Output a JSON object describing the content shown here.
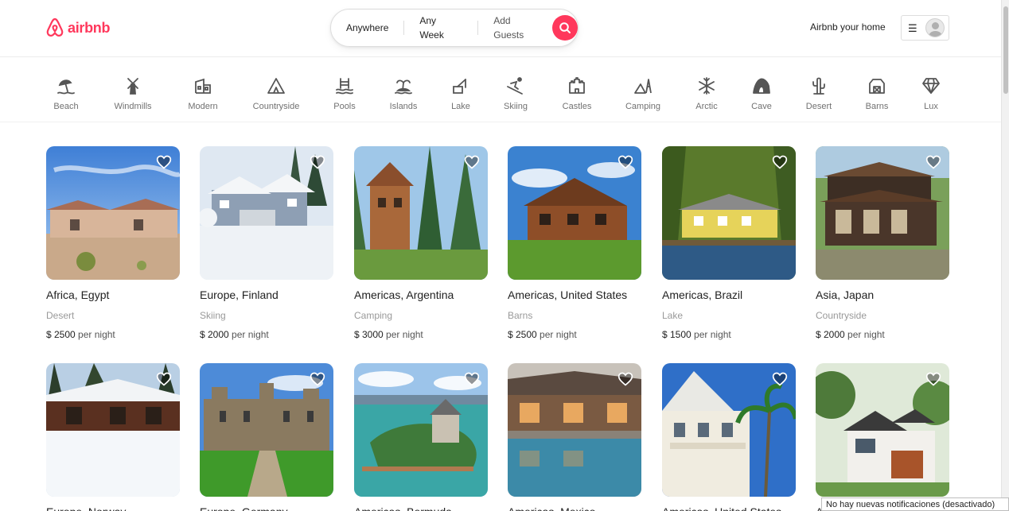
{
  "header": {
    "brand": "airbnb",
    "brand_color": "#ff385c",
    "search": {
      "where": "Anywhere",
      "when": "Any Week",
      "guests": "Add Guests"
    },
    "host_link": "Airbnb your home"
  },
  "categories": [
    {
      "label": "Beach",
      "icon": "beach-icon"
    },
    {
      "label": "Windmills",
      "icon": "windmill-icon"
    },
    {
      "label": "Modern",
      "icon": "modern-icon"
    },
    {
      "label": "Countryside",
      "icon": "countryside-icon"
    },
    {
      "label": "Pools",
      "icon": "pool-icon"
    },
    {
      "label": "Islands",
      "icon": "island-icon"
    },
    {
      "label": "Lake",
      "icon": "lake-icon"
    },
    {
      "label": "Skiing",
      "icon": "skiing-icon"
    },
    {
      "label": "Castles",
      "icon": "castle-icon"
    },
    {
      "label": "Camping",
      "icon": "camping-icon"
    },
    {
      "label": "Arctic",
      "icon": "snowflake-icon"
    },
    {
      "label": "Cave",
      "icon": "cave-icon"
    },
    {
      "label": "Desert",
      "icon": "cactus-icon"
    },
    {
      "label": "Barns",
      "icon": "barn-icon"
    },
    {
      "label": "Lux",
      "icon": "diamond-icon"
    }
  ],
  "listings": [
    {
      "location": "Africa, Egypt",
      "category": "Desert",
      "price": "$ 2500",
      "unit": "per night"
    },
    {
      "location": "Europe, Finland",
      "category": "Skiing",
      "price": "$ 2000",
      "unit": "per night"
    },
    {
      "location": "Americas, Argentina",
      "category": "Camping",
      "price": "$ 3000",
      "unit": "per night"
    },
    {
      "location": "Americas, United States",
      "category": "Barns",
      "price": "$ 2500",
      "unit": "per night"
    },
    {
      "location": "Americas, Brazil",
      "category": "Lake",
      "price": "$ 1500",
      "unit": "per night"
    },
    {
      "location": "Asia, Japan",
      "category": "Countryside",
      "price": "$ 2000",
      "unit": "per night"
    },
    {
      "location": "Europe, Norway"
    },
    {
      "location": "Europe, Germany"
    },
    {
      "location": "Americas, Bermuda"
    },
    {
      "location": "Americas, Mexico"
    },
    {
      "location": "Americas, United States"
    },
    {
      "location": "A"
    }
  ],
  "notification": "No hay nuevas notificaciones (desactivado)"
}
